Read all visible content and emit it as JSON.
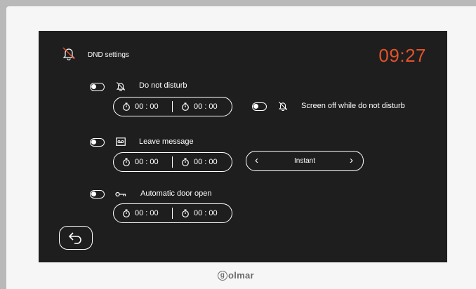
{
  "header": {
    "title": "DND settings",
    "clock": "09:27",
    "clock_color": "#e2522a",
    "title_icon": "bell-off-icon"
  },
  "dnd": {
    "label": "Do not disturb",
    "icon": "bell-off-icon",
    "start": "00 : 00",
    "end": "00 : 00"
  },
  "screen_off": {
    "label": "Screen off while do not disturb",
    "icon": "bell-off-icon"
  },
  "leave_message": {
    "label": "Leave message",
    "icon": "voicemail-icon",
    "start": "00 : 00",
    "end": "00 : 00",
    "selector_value": "Instant",
    "prev": "‹",
    "next": "›"
  },
  "auto_door": {
    "label": "Automatic door open",
    "icon": "key-icon",
    "start": "00 : 00",
    "end": "00 : 00"
  },
  "footer": {
    "back_icon": "back-arrow-icon",
    "brand_initial": "g",
    "brand_text": "olmar"
  }
}
